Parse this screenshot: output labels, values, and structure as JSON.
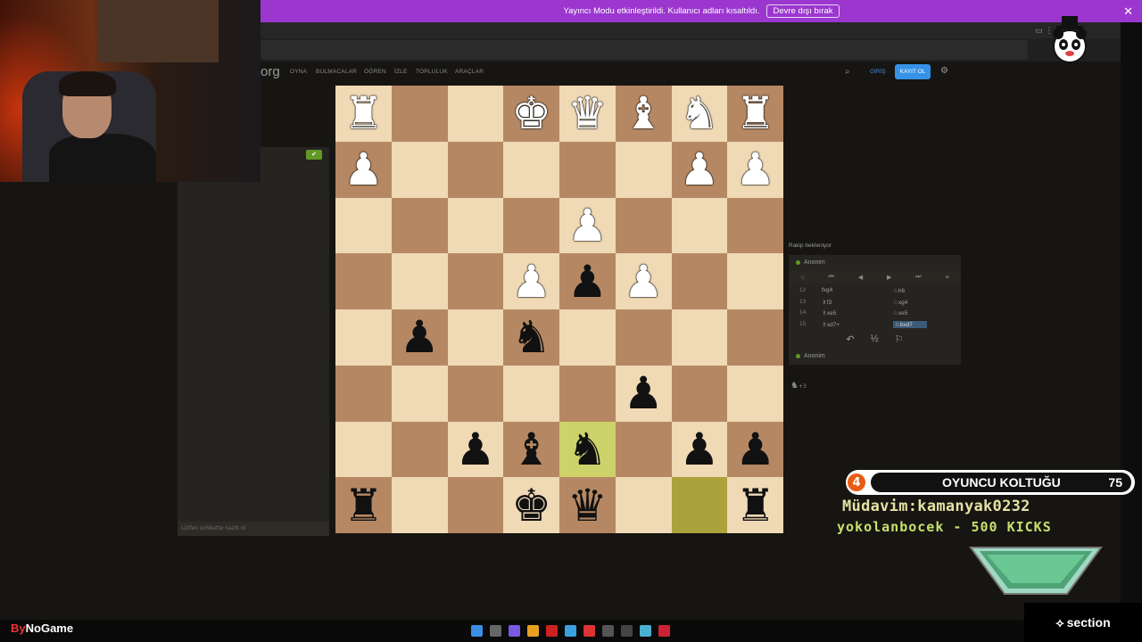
{
  "banner": {
    "message": "Yayıncı Modu etkinleştirildi. Kullanıcı adları kısaltıldı.",
    "button": "Devre dışı bırak",
    "close": "✕"
  },
  "nav": {
    "logo": "org",
    "items": [
      "OYNA",
      "BULMACALAR",
      "ÖĞREN",
      "İZLE",
      "TOPLULUK",
      "ARAÇLAR"
    ],
    "signin": "GİRİŞ",
    "register": "KAYIT OL",
    "search_icon": "⌕",
    "gear_icon": "⚙"
  },
  "chat": {
    "placeholder": "Lütfen sohbette nazik ol",
    "toggle": "✔"
  },
  "board": {
    "rows": [
      [
        "R",
        "",
        "",
        "K",
        "Q",
        "B",
        "N",
        "R"
      ],
      [
        "P",
        "",
        "",
        "",
        "",
        "",
        "P",
        "P"
      ],
      [
        "",
        "",
        "",
        "",
        "P",
        "",
        "",
        ""
      ],
      [
        "",
        "",
        "",
        "P",
        "p",
        "P",
        "",
        ""
      ],
      [
        "",
        "p",
        "",
        "n",
        "",
        "",
        "",
        ""
      ],
      [
        "",
        "",
        "",
        "",
        "",
        "p",
        "",
        ""
      ],
      [
        "",
        "",
        "p",
        "b",
        "n",
        "",
        "p",
        "p"
      ],
      [
        "r",
        "",
        "",
        "k",
        "q",
        "",
        "",
        "r"
      ]
    ],
    "highlight": [
      [
        6,
        4
      ],
      [
        7,
        6
      ]
    ],
    "glyphs": {
      "K": "♚",
      "Q": "♛",
      "R": "♜",
      "B": "♝",
      "N": "♞",
      "P": "♟",
      "k": "♚",
      "q": "♛",
      "r": "♜",
      "b": "♝",
      "n": "♞",
      "p": "♟"
    },
    "colors": {
      "light": "#f0d9b5",
      "dark": "#b58863",
      "last_move_light": "#cdd26a",
      "last_move_dark": "#aaa23a"
    }
  },
  "game": {
    "status": "Rakip bekleniyor",
    "top_player": "Anonim",
    "bottom_player": "Anonim",
    "controls": [
      "⌂",
      "⏮",
      "◀",
      "▶",
      "⏭",
      "≡"
    ],
    "moves": [
      {
        "n": "12",
        "w": "fxg4",
        "b": "♘h6"
      },
      {
        "n": "13",
        "w": "♗f3",
        "b": "♘xg4"
      },
      {
        "n": "14",
        "w": "♗xe5",
        "b": "♘xe5"
      },
      {
        "n": "15",
        "w": "♗xd7+",
        "b": "♘bxd7"
      }
    ],
    "actions": [
      "↶",
      "½",
      "⚐"
    ],
    "captured": "♞",
    "captured_count": "+3"
  },
  "overlay": {
    "seat_number": "4",
    "seat_title": "OYUNCU KOLTUĞU",
    "seat_count": "75",
    "regular": "Müdavim:kamanyak0232",
    "kicks": "yokolanbocek - 500 KICKS",
    "bynogame_by": "By",
    "bynogame_rest": "NoGame",
    "section": "section",
    "section_icon": "⟡"
  }
}
